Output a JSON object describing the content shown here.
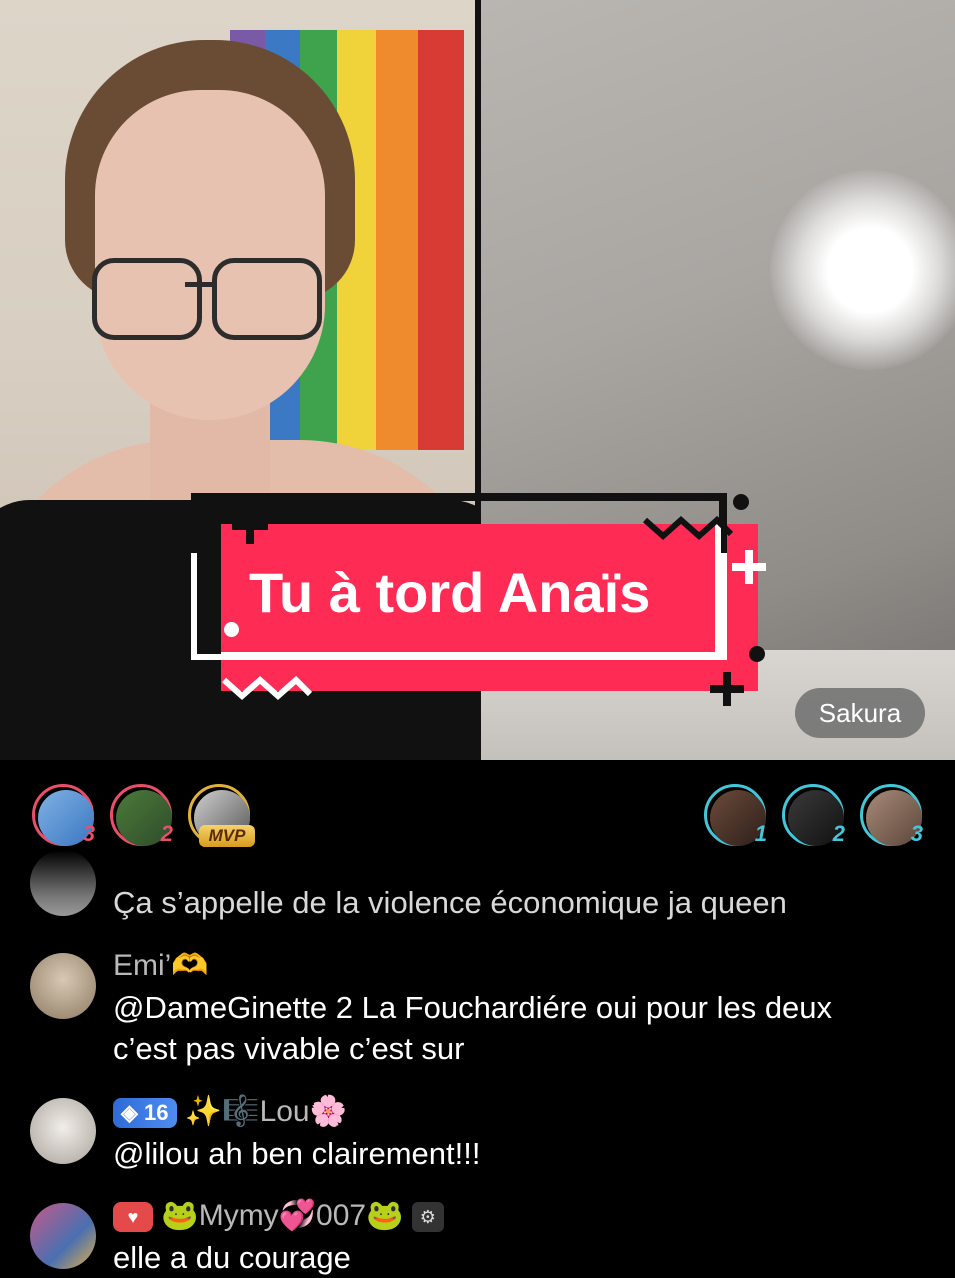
{
  "caption": {
    "text": "Tu à tord Anaïs",
    "color": "#fe2c55"
  },
  "guest_label": "Sakura",
  "top_gifters": [
    {
      "rank": "3",
      "color": "#e94f6b"
    },
    {
      "rank": "2",
      "color": "#e94f6b"
    },
    {
      "badge": "MVP"
    }
  ],
  "top_viewers": [
    {
      "rank": "1",
      "color": "#43c6d9"
    },
    {
      "rank": "2",
      "color": "#43c6d9"
    },
    {
      "rank": "3",
      "color": "#43c6d9"
    }
  ],
  "chat": [
    {
      "user": "",
      "text": "Ça s’appelle de la violence économique ja queen"
    },
    {
      "user": "Emi’🫶",
      "text_lines": [
        "@DameGinette 2 La Fouchardiére oui pour les deux",
        "c’est pas vivable c’est sur"
      ]
    },
    {
      "user": "✨🎼Lou🌸",
      "level": "16",
      "text": "@lilou ah ben clairement!!!"
    },
    {
      "user": "🐸Mymy💞007🐸",
      "text": "elle a du courage"
    }
  ]
}
